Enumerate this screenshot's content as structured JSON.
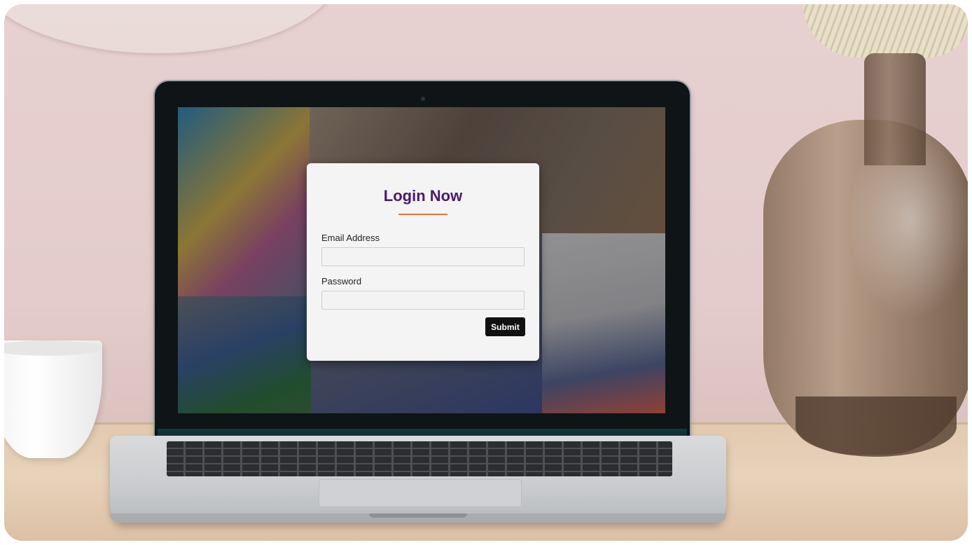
{
  "login_form": {
    "title": "Login Now",
    "email_label": "Email Address",
    "email_value": "",
    "password_label": "Password",
    "password_value": "",
    "submit_label": "Submit"
  },
  "colors": {
    "title": "#4b1a6b",
    "underline_accent": "#e07a3a",
    "submit_bg": "#111111",
    "card_bg": "#f4f4f4"
  }
}
